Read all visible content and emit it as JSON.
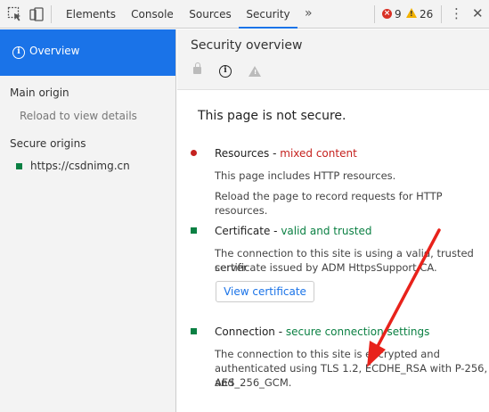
{
  "toolbar": {
    "tabs": [
      "Elements",
      "Console",
      "Sources",
      "Security"
    ],
    "active_tab": "Security",
    "more": "»",
    "errors": "9",
    "warnings": "26",
    "kebab": "⋮",
    "close": "✕"
  },
  "sidebar": {
    "overview": "Overview",
    "main_origin": "Main origin",
    "reload_hint": "Reload to view details",
    "secure_origins": "Secure origins",
    "origin": "https://csdnimg.cn"
  },
  "main": {
    "title": "Security overview",
    "status": "This page is not secure.",
    "resources": {
      "title": "Resources",
      "sep": " - ",
      "state": "mixed content",
      "line1": "This page includes HTTP resources.",
      "line2": "Reload the page to record requests for HTTP resources."
    },
    "certificate": {
      "title": "Certificate",
      "sep": " - ",
      "state": "valid and trusted",
      "line1": "The connection to this site is using a valid, trusted server",
      "line2": "certificate issued by ADM HttpsSupport CA.",
      "button": "View certificate"
    },
    "connection": {
      "title": "Connection",
      "sep": " - ",
      "state": "secure connection settings",
      "line1": "The connection to this site is encrypted and",
      "line2": "authenticated using TLS 1.2, ECDHE_RSA with P-256, and",
      "line3": "AES_256_GCM."
    }
  },
  "colors": {
    "accent": "#1a73e8",
    "insecure": "#c5221f",
    "secure": "#0b8043",
    "annotation": "#e8221b"
  }
}
